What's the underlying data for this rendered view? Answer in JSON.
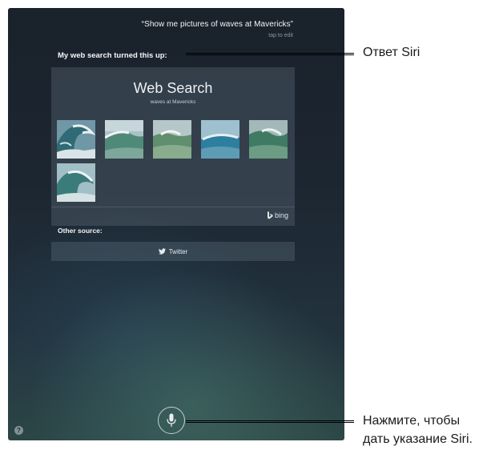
{
  "siri": {
    "query": "“Show me pictures of waves at Mavericks”",
    "tap_to_edit": "tap to edit",
    "response": "My web search turned this up:",
    "web_search": {
      "title": "Web Search",
      "subtitle": "waves at Mavericks",
      "image_count": 6,
      "provider": "bing"
    },
    "other_source_label": "Other source:",
    "twitter_label": "Twitter",
    "help_label": "?",
    "icons": {
      "bing": "bing-logo-icon",
      "twitter": "twitter-bird-icon",
      "microphone": "microphone-icon",
      "help": "help-icon"
    }
  },
  "callouts": {
    "siri_response": "Ответ Siri",
    "mic_line1": "Нажмите, чтобы",
    "mic_line2": "дать указание Siri."
  },
  "colors": {
    "screen_background": "#1c2631",
    "card_background": "#5c6c7a",
    "text_light": "#f2f4f6"
  }
}
